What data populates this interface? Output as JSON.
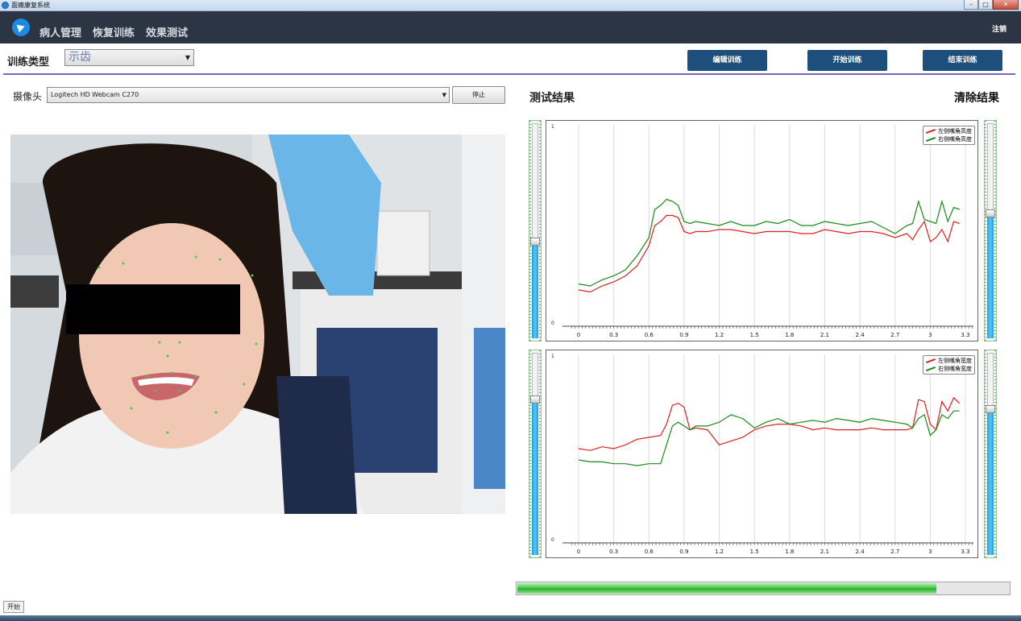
{
  "window": {
    "title": "面瘫康复系统",
    "buttons": [
      "–",
      "□",
      "✕"
    ]
  },
  "nav": {
    "items": [
      "病人管理",
      "恢复训练",
      "效果测试"
    ],
    "logout": "注销"
  },
  "toolbar": {
    "type_label": "训练类型",
    "type_value": "示齿",
    "buttons": [
      "编辑训练",
      "开始训练",
      "结束训练"
    ]
  },
  "camera": {
    "label": "摄像头",
    "device": "Logitech HD Webcam C270",
    "stop_label": "停止"
  },
  "results": {
    "title": "测试结果",
    "clear_label": "清除结果"
  },
  "colors": {
    "series_left": "#e02020",
    "series_right": "#1a8a1a",
    "nav_bg": "#2b3544",
    "button_bg": "#1e4f7c"
  },
  "sliders": {
    "chart1_left": 0.45,
    "chart1_right": 0.58,
    "chart2_left": 0.77,
    "chart2_right": 0.72
  },
  "progress": 0.85,
  "status": {
    "start_label": "开始"
  },
  "chart_data": [
    {
      "type": "line",
      "xlim": [
        0,
        3.3
      ],
      "ylim": [
        0,
        1
      ],
      "x_ticks": [
        "0",
        "0.3",
        "0.6",
        "0.9",
        "1.2",
        "1.5",
        "1.8",
        "2.1",
        "2.4",
        "2.7",
        "3",
        "3.3"
      ],
      "y_ticks": [
        "1",
        "0"
      ],
      "legend_position": "top-right",
      "series": [
        {
          "name": "左侧嘴角高度",
          "color": "#e02020",
          "x": [
            0,
            0.1,
            0.2,
            0.3,
            0.4,
            0.5,
            0.6,
            0.65,
            0.7,
            0.75,
            0.8,
            0.85,
            0.9,
            0.95,
            1.0,
            1.1,
            1.2,
            1.3,
            1.4,
            1.5,
            1.6,
            1.7,
            1.8,
            1.9,
            2.0,
            2.1,
            2.2,
            2.3,
            2.4,
            2.5,
            2.6,
            2.7,
            2.8,
            2.85,
            2.9,
            2.95,
            3.0,
            3.05,
            3.1,
            3.15,
            3.2,
            3.25
          ],
          "y": [
            0.18,
            0.17,
            0.2,
            0.22,
            0.25,
            0.3,
            0.4,
            0.5,
            0.52,
            0.55,
            0.55,
            0.54,
            0.47,
            0.46,
            0.47,
            0.47,
            0.48,
            0.48,
            0.47,
            0.46,
            0.47,
            0.47,
            0.47,
            0.46,
            0.46,
            0.48,
            0.47,
            0.46,
            0.47,
            0.47,
            0.46,
            0.44,
            0.46,
            0.43,
            0.48,
            0.52,
            0.42,
            0.44,
            0.48,
            0.42,
            0.52,
            0.51
          ]
        },
        {
          "name": "右侧嘴角高度",
          "color": "#1a8a1a",
          "x": [
            0,
            0.1,
            0.2,
            0.3,
            0.4,
            0.5,
            0.6,
            0.65,
            0.7,
            0.75,
            0.8,
            0.85,
            0.9,
            0.95,
            1.0,
            1.1,
            1.2,
            1.3,
            1.4,
            1.5,
            1.6,
            1.7,
            1.8,
            1.9,
            2.0,
            2.1,
            2.2,
            2.3,
            2.4,
            2.5,
            2.6,
            2.7,
            2.8,
            2.85,
            2.9,
            2.95,
            3.0,
            3.05,
            3.1,
            3.15,
            3.2,
            3.25
          ],
          "y": [
            0.21,
            0.2,
            0.23,
            0.25,
            0.28,
            0.35,
            0.44,
            0.58,
            0.6,
            0.63,
            0.62,
            0.6,
            0.52,
            0.51,
            0.52,
            0.51,
            0.5,
            0.52,
            0.5,
            0.5,
            0.52,
            0.51,
            0.53,
            0.5,
            0.5,
            0.52,
            0.51,
            0.5,
            0.51,
            0.52,
            0.49,
            0.46,
            0.5,
            0.51,
            0.62,
            0.53,
            0.52,
            0.51,
            0.62,
            0.52,
            0.59,
            0.58
          ]
        }
      ]
    },
    {
      "type": "line",
      "xlim": [
        0,
        3.3
      ],
      "ylim": [
        0,
        1
      ],
      "x_ticks": [
        "0",
        "0.3",
        "0.6",
        "0.9",
        "1.2",
        "1.5",
        "1.8",
        "2.1",
        "2.4",
        "2.7",
        "3",
        "3.3"
      ],
      "y_ticks": [
        "1",
        "0"
      ],
      "legend_position": "top-right",
      "series": [
        {
          "name": "左侧嘴角宽度",
          "color": "#e02020",
          "x": [
            0,
            0.1,
            0.2,
            0.3,
            0.4,
            0.5,
            0.6,
            0.7,
            0.75,
            0.8,
            0.85,
            0.9,
            0.95,
            1.0,
            1.1,
            1.2,
            1.3,
            1.4,
            1.5,
            1.6,
            1.7,
            1.8,
            1.9,
            2.0,
            2.1,
            2.2,
            2.3,
            2.4,
            2.5,
            2.6,
            2.7,
            2.8,
            2.85,
            2.9,
            2.95,
            3.0,
            3.05,
            3.1,
            3.15,
            3.2,
            3.25
          ],
          "y": [
            0.5,
            0.49,
            0.51,
            0.5,
            0.52,
            0.55,
            0.56,
            0.57,
            0.63,
            0.73,
            0.74,
            0.72,
            0.6,
            0.61,
            0.6,
            0.52,
            0.54,
            0.56,
            0.6,
            0.62,
            0.63,
            0.63,
            0.62,
            0.6,
            0.61,
            0.6,
            0.6,
            0.6,
            0.61,
            0.6,
            0.6,
            0.6,
            0.61,
            0.76,
            0.75,
            0.63,
            0.6,
            0.75,
            0.7,
            0.77,
            0.74
          ]
        },
        {
          "name": "右侧嘴角宽度",
          "color": "#1a8a1a",
          "x": [
            0,
            0.1,
            0.2,
            0.3,
            0.4,
            0.5,
            0.6,
            0.7,
            0.75,
            0.8,
            0.85,
            0.9,
            0.95,
            1.0,
            1.1,
            1.2,
            1.3,
            1.4,
            1.5,
            1.6,
            1.7,
            1.8,
            1.9,
            2.0,
            2.1,
            2.2,
            2.3,
            2.4,
            2.5,
            2.6,
            2.7,
            2.8,
            2.85,
            2.9,
            2.95,
            3.0,
            3.05,
            3.1,
            3.15,
            3.2,
            3.25
          ],
          "y": [
            0.44,
            0.43,
            0.43,
            0.42,
            0.42,
            0.41,
            0.42,
            0.42,
            0.52,
            0.62,
            0.64,
            0.62,
            0.6,
            0.62,
            0.62,
            0.64,
            0.68,
            0.66,
            0.61,
            0.64,
            0.66,
            0.63,
            0.64,
            0.65,
            0.64,
            0.66,
            0.65,
            0.64,
            0.66,
            0.65,
            0.64,
            0.63,
            0.61,
            0.66,
            0.68,
            0.57,
            0.6,
            0.68,
            0.66,
            0.7,
            0.7
          ]
        }
      ]
    }
  ]
}
